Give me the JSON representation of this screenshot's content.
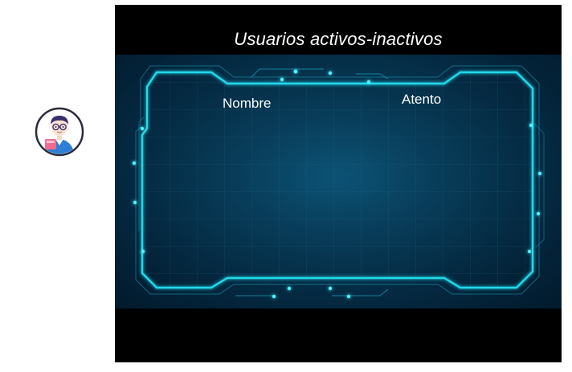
{
  "panel": {
    "title": "Usuarios activos-inactivos",
    "columns": {
      "name_label": "Nombre",
      "attentive_label": "Atento"
    }
  },
  "avatar": {
    "icon": "user-avatar-icon"
  },
  "colors": {
    "panel_background": "#000000",
    "screen_glow": "#1fd3e6",
    "screen_dark": "#032238",
    "text": "#ffffff"
  }
}
